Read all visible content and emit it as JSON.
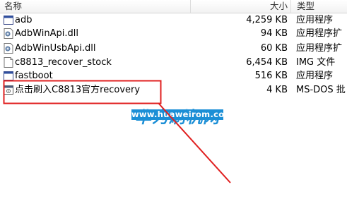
{
  "columns": {
    "name": "名称",
    "size": "大小",
    "type": "类型"
  },
  "files": [
    {
      "name": "adb",
      "size": "4,259 KB",
      "type": "应用程序",
      "icon": "exe-icon"
    },
    {
      "name": "AdbWinApi.dll",
      "size": "94 KB",
      "type": "应用程序扩",
      "icon": "dll-icon"
    },
    {
      "name": "AdbWinUsbApi.dll",
      "size": "60 KB",
      "type": "应用程序扩",
      "icon": "dll-icon"
    },
    {
      "name": "c8813_recover_stock",
      "size": "6,454 KB",
      "type": "IMG 文件",
      "icon": "img-file-icon"
    },
    {
      "name": "fastboot",
      "size": "516 KB",
      "type": "应用程序",
      "icon": "exe-icon"
    },
    {
      "name": "点击刷入C8813官方recovery",
      "size": "4 KB",
      "type": "MS-DOS 批",
      "icon": "batch-file-icon"
    }
  ],
  "watermark": {
    "name": "华为刷机网",
    "url": "www.huaweirom.com"
  },
  "colors": {
    "annotation": "#e02020",
    "watermark": "#1c8fd6"
  }
}
